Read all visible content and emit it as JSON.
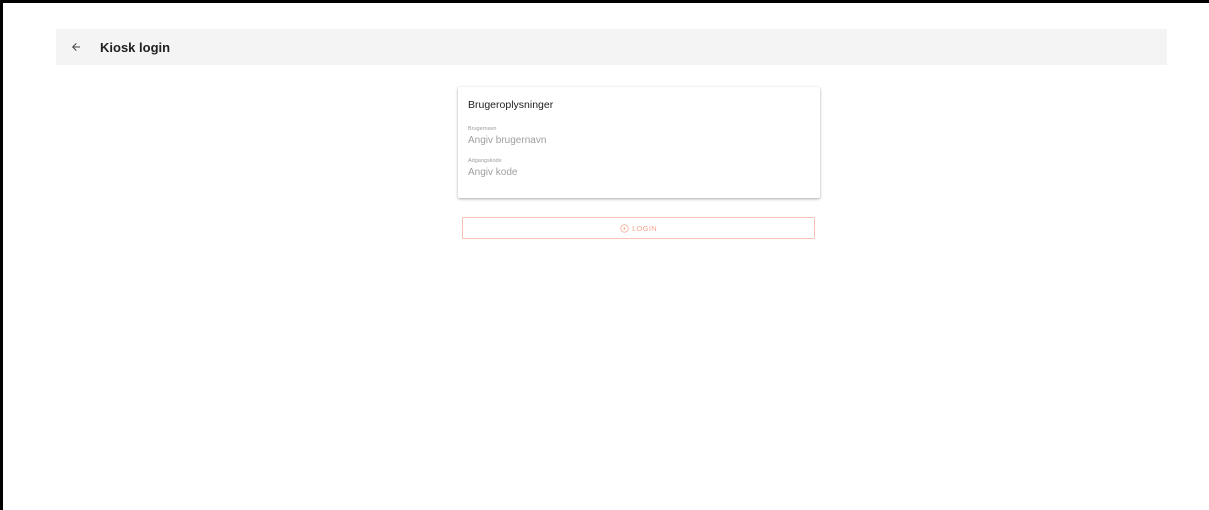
{
  "header": {
    "back_icon": "arrow-left-icon",
    "title": "Kiosk login"
  },
  "card": {
    "title": "Brugeroplysninger",
    "username": {
      "label": "Brugernavn",
      "placeholder": "Angiv brugernavn",
      "value": ""
    },
    "password": {
      "label": "Adgangskode",
      "placeholder": "Angiv kode",
      "value": ""
    }
  },
  "login_button": {
    "icon": "circle-arrow-icon",
    "label": "LOGIN",
    "color": "#f4a58f",
    "border_color": "#f7c2b4"
  }
}
